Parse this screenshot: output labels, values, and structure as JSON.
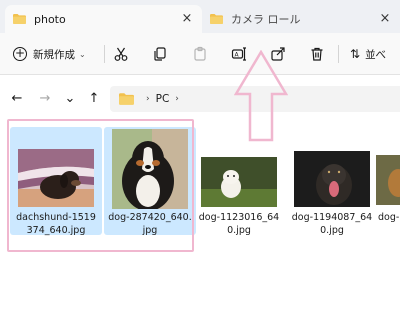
{
  "tabs": [
    {
      "title": "photo",
      "close": "×",
      "active": true
    },
    {
      "title": "カメラ ロール",
      "close": "×",
      "active": false
    }
  ],
  "toolbar": {
    "new_label": "新規作成",
    "new_chevron": "⌄",
    "icons": [
      "cut-icon",
      "copy-icon",
      "paste-icon",
      "rename-icon",
      "share-icon",
      "delete-icon"
    ],
    "sort_label": "並べ"
  },
  "address": {
    "back": "←",
    "forward": "→",
    "recent": "⌄",
    "up": "↑",
    "chevron": "›",
    "path": [
      "PC"
    ]
  },
  "files": [
    {
      "name": "dachshund-1519374_640.jpg",
      "selected": true
    },
    {
      "name": "dog-287420_640.jpg",
      "selected": true
    },
    {
      "name": "dog-1123016_640.jpg",
      "selected": false
    },
    {
      "name": "dog-1194087_640.jpg",
      "selected": false
    },
    {
      "name": "dog-",
      "selected": false
    }
  ],
  "colors": {
    "selection": "#cce8ff",
    "annotation": "#f0b7cf",
    "folder": "#f2c14e"
  }
}
